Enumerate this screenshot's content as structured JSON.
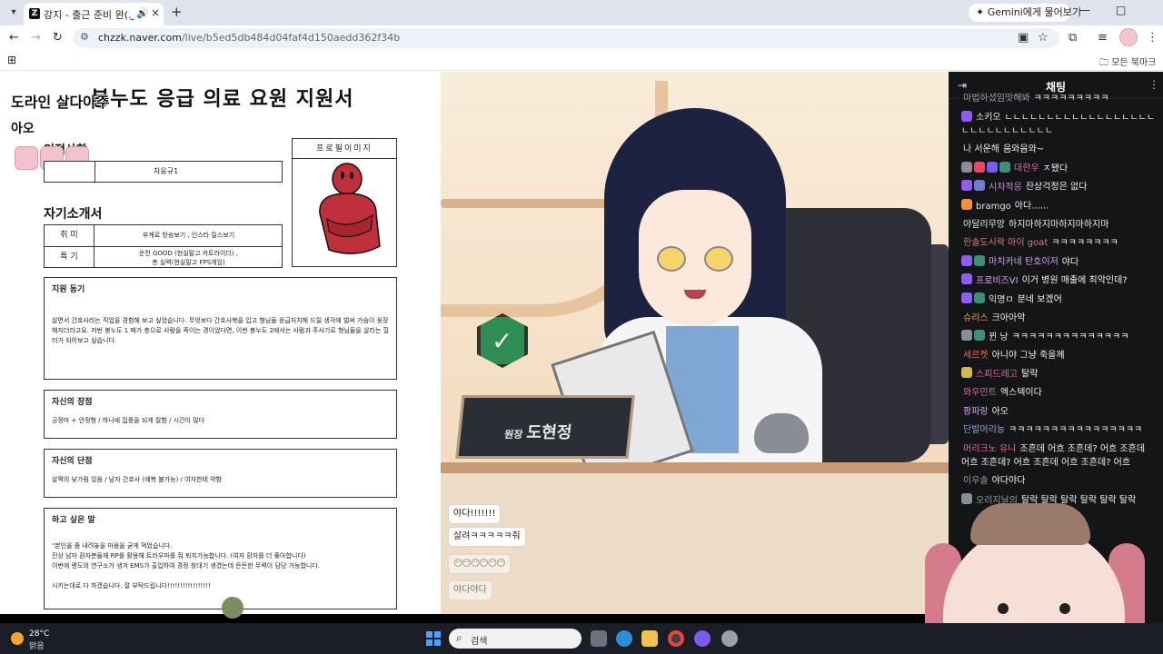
{
  "browser": {
    "tab": {
      "favicon": "Z",
      "title": "강지 - 출근 준비 완(. ̫ .)",
      "audio_icon": "speaker-icon",
      "close": "×"
    },
    "new_tab": "+",
    "gemini_button": "Gemini에게 물어보기",
    "nav": {
      "back": "←",
      "forward": "→",
      "reload": "↻"
    },
    "url_host": "chzzk.naver.com",
    "url_path": "/live/b5ed5db484d04faf4d150aedd362f34b",
    "bookmarks_all": "모든 북마크"
  },
  "document": {
    "title": "봉누도 응급 의료 요원 지원서",
    "overlay_line1": "도라인 살다아주",
    "overlay_line2": "아오",
    "personal_label": "인적사항",
    "name_value": "차응규1",
    "photo_label": "프로필이미지",
    "intro_label": "자기소개서",
    "hobby_key": "취 미",
    "hobby_value": "부계로 방송보기 , 인스타 릴스보기",
    "skill_key": "특 기",
    "skill_value_line1": "운전 GOOD (현실말고 카트라이더) ,",
    "skill_value_line2": "총 실력(현실말고 FPS게임)",
    "motive_head": "지원 동기",
    "motive_body": "살면서 간호사라는 직업을 경험해 보고 싶었습니다. 무엇보다 간호사복을 입고 형님들 응급처치해 드릴 생각에 벌써 가슴이 웅장해지더라고요. 저번 봉누도 1 때가 총으로 사람을 죽이는 경이었다면, 이번 봉누도 2에서는 사람과 주사기로 형님들을 살리는 힐러가 되어보고 싶습니다.",
    "strength_head": "자신의 장점",
    "strength_body": "긍정마 + 안정형 / 하나에 집중을 되게 잘함 / 시간이 많다",
    "weakness_head": "자신의 단점",
    "weakness_body": "살짝의 낯가림 있음 / 남자 간호사 (예복 불가능) / 여자한테 약함",
    "wish_head": "하고 싶은 말",
    "wish_line1": "\"본인을 좀 내려놓을 마음을 굳게 먹었습니다.",
    "wish_line2": "진상 남자 환자분들께 RP를 활용해 트러우마를 줘 퇴치가능합니다. (여자 환자를 더 좋아합니다)",
    "wish_line3": "이번에 랜도의 연구소가 생겨 EMS가 출입하여 경정 창대기 생겼는데 든든한 무력이 담당 가능합니다.",
    "wish_line4": "시키는대로 다 하겠습니다. 잘 부탁드립니다!!!!!!!!!!!!!!!!!"
  },
  "scene": {
    "nameplate_small": "원장",
    "nameplate_name": "도현정",
    "badge_icon": "check-badge-icon",
    "bubbles": [
      "야다!!!!!!!",
      "살려ㅋㅋㅋㅋㅋ줘",
      "😶😶😶😶😶😶",
      "야다야다"
    ]
  },
  "chat": {
    "title": "채팅",
    "messages": [
      {
        "nick": "마법하셨임맛해봐",
        "text": "ㅋㅋㅋㅋㅋㅋㅋㅋㅋ",
        "nick_color": "#9aa0a6",
        "badges": []
      },
      {
        "nick": "소키오",
        "text": "ㄴㄴㄴㄴㄴㄴㄴㄴㄴㄴㄴㄴㄴㄴㄴㄴㄴㄴㄴㄴㄴㄴㄴㄴㄴㄴㄴㄴㄴ",
        "nick_color": "#e6e6e6",
        "badges": [
          "#8e5cf7"
        ]
      },
      {
        "nick": "나 서운해",
        "text": "음와음와~",
        "nick_color": "#e6e6e6",
        "badges": []
      },
      {
        "nick": "대한우",
        "text": "ㅈ됐다",
        "nick_color": "#e66aa6",
        "badges": [
          "#8a8d96",
          "#e8466b",
          "#7a5cf0",
          "#3b8f7b"
        ]
      },
      {
        "nick": "시차적응",
        "text": "잔상걱정은 없다",
        "nick_color": "#c58be8",
        "badges": [
          "#8e5cf7",
          "#6b7fd6"
        ]
      },
      {
        "nick": "bramgo",
        "text": "아다......",
        "nick_color": "#e6e6e6",
        "badges": [
          "#f0913b"
        ]
      },
      {
        "nick": "야달리무망",
        "text": "하지마하지마하지마하지마",
        "nick_color": "#e6e6e6",
        "badges": []
      },
      {
        "nick": "한솔도시락 마이 goat",
        "text": "ㅋㅋㅋㅋㅋㅋㅋㅋ",
        "nick_color": "#d97a7a",
        "badges": []
      },
      {
        "nick": "마치카네 탄호이저",
        "text": "야다",
        "nick_color": "#d6a6f0",
        "badges": [
          "#8e5cf7",
          "#3b8f7b"
        ]
      },
      {
        "nick": "프로비즈VI",
        "text": "이거 병원 매출에 최악인데?",
        "nick_color": "#d6a6f0",
        "badges": [
          "#8e5cf7"
        ]
      },
      {
        "nick": "익명ㅁ",
        "text": "분네 보겠어",
        "nick_color": "#e6e6e6",
        "badges": [
          "#8e5cf7",
          "#3b8f7b"
        ]
      },
      {
        "nick": "슈리스",
        "text": "크아아악",
        "nick_color": "#e8a05a",
        "badges": []
      },
      {
        "nick": "뀐 낭",
        "text": "ㅋㅋㅋㅋㅋㅋㅋㅋㅋㅋㅋㅋㅋㅋ",
        "nick_color": "#e6e6e6",
        "badges": [
          "#8a8d96",
          "#3b8f7b"
        ]
      },
      {
        "nick": "세르켓",
        "text": "아니야 그냥 죽을께",
        "nick_color": "#e66a6a",
        "badges": []
      },
      {
        "nick": "스피드레고",
        "text": "탈락",
        "nick_color": "#e66aa6",
        "badges": [
          "#d4b84a"
        ]
      },
      {
        "nick": "와우민트",
        "text": "엑스텍이다",
        "nick_color": "#e66aa6",
        "badges": []
      },
      {
        "nick": "팡파랑",
        "text": "아오",
        "nick_color": "#d6a6f0",
        "badges": []
      },
      {
        "nick": "단발머리능",
        "text": "ㅋㅋㅋㅋㅋㅋㅋㅋㅋㅋㅋㅋㅋㅋㅋㅋ",
        "nick_color": "#9aa0e6",
        "badges": []
      },
      {
        "nick": "머리크노 유니",
        "text": "조흔데 어흐 조흔데? 어흐 조흔데 어흐 조흔데? 어흐 조흔데 어흐 조흔데? 어흐",
        "nick_color": "#e66aa6",
        "badges": []
      },
      {
        "nick": "이우솔",
        "text": "야다야다",
        "nick_color": "#9aa0a6",
        "badges": []
      },
      {
        "nick": "오리지날의",
        "text": "탈락 탈락 탈락 탈락 탈락 탈락",
        "nick_color": "#9aa0a6",
        "badges": [
          "#8a8d96"
        ]
      }
    ]
  },
  "taskbar": {
    "temperature": "28°C",
    "condition": "맑음",
    "search_placeholder": "검색",
    "apps": [
      "task-view-icon",
      "edge-icon",
      "file-explorer-icon",
      "chrome-icon",
      "copilot-icon",
      "settings-icon"
    ]
  },
  "colors": {
    "tabstrip": "#dfe3ec",
    "chat_bg": "#141517",
    "taskbar_bg": "#1b1e27",
    "accent_purple": "#8e5cf7"
  }
}
